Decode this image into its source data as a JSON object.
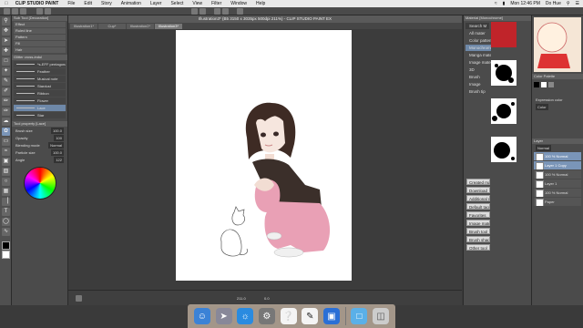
{
  "menubar": {
    "app_name": "CLIP STUDIO PAINT",
    "items": [
      "File",
      "Edit",
      "Story",
      "Animation",
      "Layer",
      "Select",
      "View",
      "Filter",
      "Window",
      "Help"
    ],
    "clock": "Mon 12:46 PM",
    "user": "Do Hue"
  },
  "window": {
    "title": "Illustration3* (B5 3150 x 3035px 500dpi 211%) - CLIP STUDIO PAINT EX",
    "tabs": [
      "Illustration1*",
      "Cup*",
      "Illustration2*",
      "Illustration3*"
    ],
    "active_tab_index": 3
  },
  "left_panel": {
    "subtool_title": "Sub Tool [Decoration]",
    "subtools": [
      "Effect",
      "Ruled line",
      "Pattern",
      "Fill",
      "Hair"
    ],
    "brush_group_title": "Glitter cross-indul",
    "brushes": [
      "*s-EFF pentagonal",
      "Feather",
      "Musical note",
      "Stardust",
      "Ribbon",
      "Flower",
      "Lace",
      "Star"
    ],
    "property_title": "Tool property [Lace]",
    "properties": [
      {
        "label": "Brush size",
        "value": "100.0"
      },
      {
        "label": "Opacity",
        "value": "100"
      },
      {
        "label": "Blending mode",
        "value": "Normal"
      },
      {
        "label": "Particle size",
        "value": "100.0"
      },
      {
        "label": "Angle",
        "value": "122"
      }
    ]
  },
  "navigator": {
    "zoom": "211.0",
    "angle": "0.0"
  },
  "material_panel": {
    "title": "Material [Monochrome]",
    "search_placeholder": "Search M",
    "folders": [
      "All mater",
      "Color pattern",
      "Monochrome",
      "Manga material",
      "Image material",
      "3D",
      "Brush",
      "Image",
      "Brush tip"
    ],
    "buttons": [
      "Created ma",
      "Download",
      "Additional m",
      "Default tag",
      "Favorites",
      "Image mater",
      "Brush tool",
      "Brush shape",
      "Other tool"
    ]
  },
  "right_panel": {
    "color_title": "Color Palette",
    "expression_label": "Expression color",
    "expression_value": "Color",
    "layer_title": "Layer",
    "blend_mode": "Normal",
    "layers": [
      {
        "name": "100 % Normal",
        "selected": true
      },
      {
        "name": "Layer 1 Copy",
        "selected": true
      },
      {
        "name": "100 % Normal",
        "selected": false
      },
      {
        "name": "Layer 1",
        "selected": false
      },
      {
        "name": "100 % Normal",
        "selected": false
      },
      {
        "name": "Paper",
        "selected": false
      }
    ]
  },
  "dock": {
    "apps": [
      "finder-icon",
      "launchpad-icon",
      "safari-icon",
      "system-preferences-icon",
      "clip-studio-icon",
      "clip-studio-paint-icon",
      "preview-icon",
      "folder-icon",
      "trash-icon"
    ]
  }
}
